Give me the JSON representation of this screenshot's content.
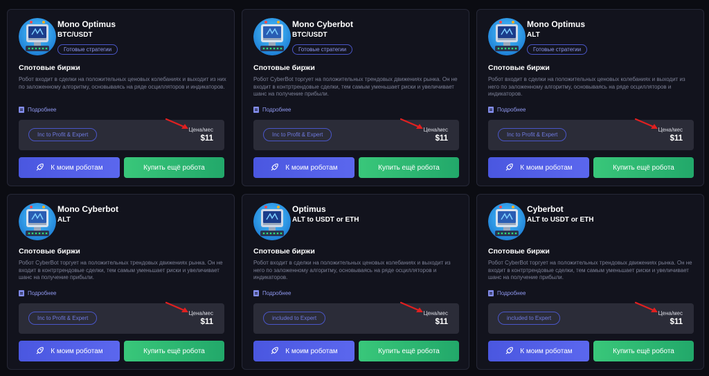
{
  "common": {
    "strategy_tag": "Готовые стратегии",
    "section_title": "Спотовые биржи",
    "more_link": "Подробнее",
    "price_label": "Цена/мес",
    "price": "$11",
    "btn_robots": "К моим роботам",
    "btn_buy": "Купить ещё робота",
    "arrow_color": "#e02020",
    "robots_btn_color": "#4f5ce6",
    "buy_btn_color": "#2fb874"
  },
  "cards": [
    {
      "title": "Mono Optimus",
      "pair": "BTC/USDT",
      "description": "Робот входит в сделки на положительных ценовых колебаниях и выходит из них по заложенному алгоритму, основываясь на ряде осцилляторов и индикаторов.",
      "plan": "Inc to Profit & Expert",
      "avatar": "optimus-robot-icon"
    },
    {
      "title": "Mono Cyberbot",
      "pair": "BTC/USDT",
      "description": "Робот CyberBot торгует на положительных трендовых движениях рынка.  Он не входит в контртрендовые сделки, тем самым уменьшает риски и увеличивает шанс на получение прибыли.",
      "plan": "Inc to Profit & Expert",
      "avatar": "cyberbot-robot-icon"
    },
    {
      "title": "Mono Optimus",
      "pair": "ALT",
      "description": "Робот входит в сделки на положительных ценовых колебаниях и выходит из него по заложенному алгоритму, основываясь на ряде осцилляторов и индикаторов.",
      "plan": "Inc to Profit & Expert",
      "avatar": "optimus-robot-icon"
    },
    {
      "title": "Mono Cyberbot",
      "pair": "ALT",
      "description": "Робот CyberBot торгует на положительных трендовых движениях рынка.  Он не входит в контртрендовые сделки, тем самым уменьшает риски и увеличивает шанс на получение прибыли.",
      "plan": "Inc to Profit & Expert",
      "avatar": "cyberbot-robot-icon"
    },
    {
      "title": "Optimus",
      "pair": "ALT to USDT or ETH",
      "description": "Робот входит в сделки на положительных ценовых колебаниях и выходит из него по заложенному алгоритму, основываясь на ряде осцилляторов и индикаторов.",
      "plan": "included to Expert",
      "avatar": "optimus-robot-icon"
    },
    {
      "title": "Cyberbot",
      "pair": "ALT to USDT or ETH",
      "description": "Робот CyberBot торгует на положительных трендовых движениях рынка.  Он не входит в контртрендовые сделки, тем самым уменьшает риски и увеличивает шанс на получение прибыли.",
      "plan": "included to Expert",
      "avatar": "cyberbot-robot-icon"
    }
  ]
}
